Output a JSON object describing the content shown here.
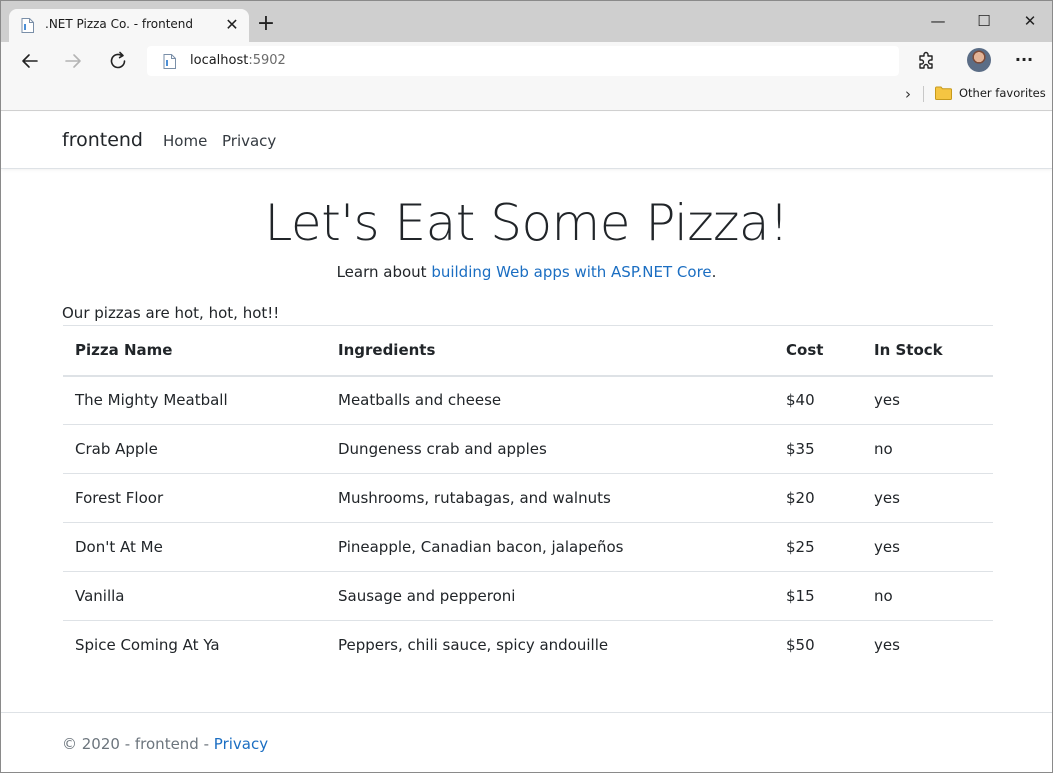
{
  "browser": {
    "tab_title": ".NET Pizza Co. - frontend",
    "tab_close_glyph": "✕",
    "new_tab_glyph": "+",
    "window_controls": {
      "minimize": "—",
      "maximize": "☐",
      "close": "✕"
    },
    "address_host": "localhost",
    "address_port": ":5902",
    "more_glyph": "···",
    "favorites_chevron": "›",
    "favorites_label": "Other favorites",
    "icons": {
      "back": "arrow-left-icon",
      "forward": "arrow-right-icon",
      "refresh": "refresh-icon",
      "page": "page-icon",
      "extensions": "extensions-icon",
      "folder": "folder-icon"
    },
    "colors": {
      "tabstrip": "#cfcfcf",
      "toolbar": "#f7f7f7",
      "folder": "#f5c542"
    }
  },
  "site": {
    "brand": "frontend",
    "nav": [
      {
        "label": "Home"
      },
      {
        "label": "Privacy"
      }
    ]
  },
  "hero": {
    "title": "Let's Eat Some Pizza!",
    "subtitle_prefix": "Learn about ",
    "subtitle_link": "building Web apps with ASP.NET Core",
    "subtitle_suffix": "."
  },
  "intro": "Our pizzas are hot, hot, hot!!",
  "table": {
    "headers": [
      "Pizza Name",
      "Ingredients",
      "Cost",
      "In Stock"
    ],
    "rows": [
      [
        "The Mighty Meatball",
        "Meatballs and cheese",
        "$40",
        "yes"
      ],
      [
        "Crab Apple",
        "Dungeness crab and apples",
        "$35",
        "no"
      ],
      [
        "Forest Floor",
        "Mushrooms, rutabagas, and walnuts",
        "$20",
        "yes"
      ],
      [
        "Don't At Me",
        "Pineapple, Canadian bacon, jalapeños",
        "$25",
        "yes"
      ],
      [
        "Vanilla",
        "Sausage and pepperoni",
        "$15",
        "no"
      ],
      [
        "Spice Coming At Ya",
        "Peppers, chili sauce, spicy andouille",
        "$50",
        "yes"
      ]
    ]
  },
  "footer": {
    "text": "© 2020 - frontend - ",
    "link": "Privacy"
  },
  "colors": {
    "link": "#1b6ec2",
    "muted": "#6c757d",
    "border": "#dee2e6"
  }
}
